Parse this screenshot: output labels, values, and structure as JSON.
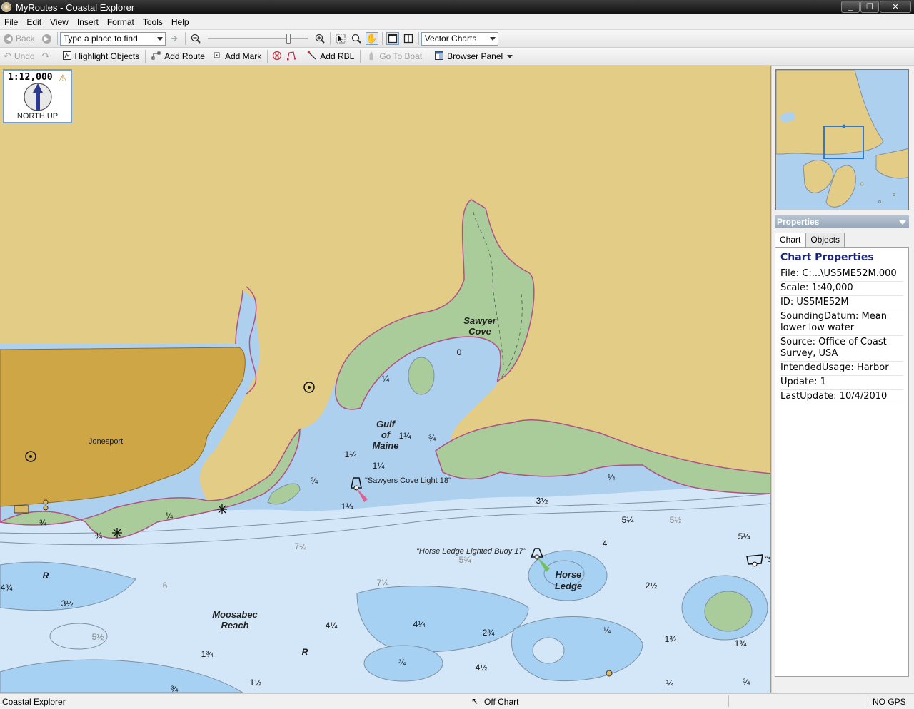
{
  "window": {
    "title": "MyRoutes - Coastal Explorer",
    "min": "_",
    "max": "❐",
    "close": "✕"
  },
  "menubar": {
    "items": [
      "File",
      "Edit",
      "View",
      "Insert",
      "Format",
      "Tools",
      "Help"
    ]
  },
  "toolbar1": {
    "back_label": "Back",
    "search_placeholder": "Type a place to find",
    "zoom_level": 0.82,
    "chart_type": "Vector Charts"
  },
  "toolbar2": {
    "undo_label": "Undo",
    "highlight_label": "Highlight Objects",
    "add_route_label": "Add Route",
    "add_mark_label": "Add Mark",
    "add_rbl_label": "Add RBL",
    "go_to_boat_label": "Go To Boat",
    "browser_panel_label": "Browser Panel"
  },
  "map": {
    "scale": "1:12,000",
    "orientation": "NORTH UP",
    "place_names": {
      "sawyer_cove": [
        "Sawyer",
        "Cove"
      ],
      "gulf_of_maine": [
        "Gulf",
        "of",
        "Maine"
      ],
      "jonesport": "Jonesport",
      "moosabec_reach": [
        "Moosabec",
        "Reach"
      ],
      "horse_ledge": [
        "Horse",
        "Ledge"
      ]
    },
    "buoy_labels": {
      "sawyers_cove": "\"Sawyers Cove Light 18\"",
      "horse_ledge": "\"Horse Ledge Lighted Buoy 17\"",
      "edge": "\"S"
    },
    "soundings": [
      "0",
      "¼",
      "1¼",
      "¾",
      "1¼",
      "1¼",
      "¾",
      "1¼",
      "¼",
      "3½",
      "5¼",
      "5½",
      "5¼",
      "4",
      "5¾",
      "2½",
      "¾",
      "¼",
      "¾",
      "R",
      "4¾",
      "3½",
      "7½",
      "6",
      "7¼",
      "5½",
      "4¼",
      "4¼",
      "2¾",
      "¼",
      "1¾",
      "1¾",
      "R",
      "1¾",
      "¾",
      "4½",
      "¼",
      "¾",
      "1½",
      "¾"
    ]
  },
  "sidebar": {
    "properties_title": "Properties",
    "tabs": [
      "Chart",
      "Objects"
    ],
    "heading": "Chart Properties",
    "rows": [
      "File: C:...\\US5ME52M.000",
      "Scale: 1:40,000",
      "ID: US5ME52M",
      "SoundingDatum: Mean lower low water",
      "Source: Office of Coast Survey, USA",
      "IntendedUsage: Harbor",
      "Update: 1",
      "LastUpdate: 10/4/2010"
    ]
  },
  "status": {
    "left": "Coastal Explorer",
    "middle": "Off Chart",
    "right": "NO GPS"
  },
  "colors": {
    "land": "#e3cc86",
    "urban": "#cfa646",
    "shoal": "#a5d2f4",
    "deep": "#d2e6f8",
    "intertidal": "#a8cc9a",
    "coast": "#b05088"
  }
}
